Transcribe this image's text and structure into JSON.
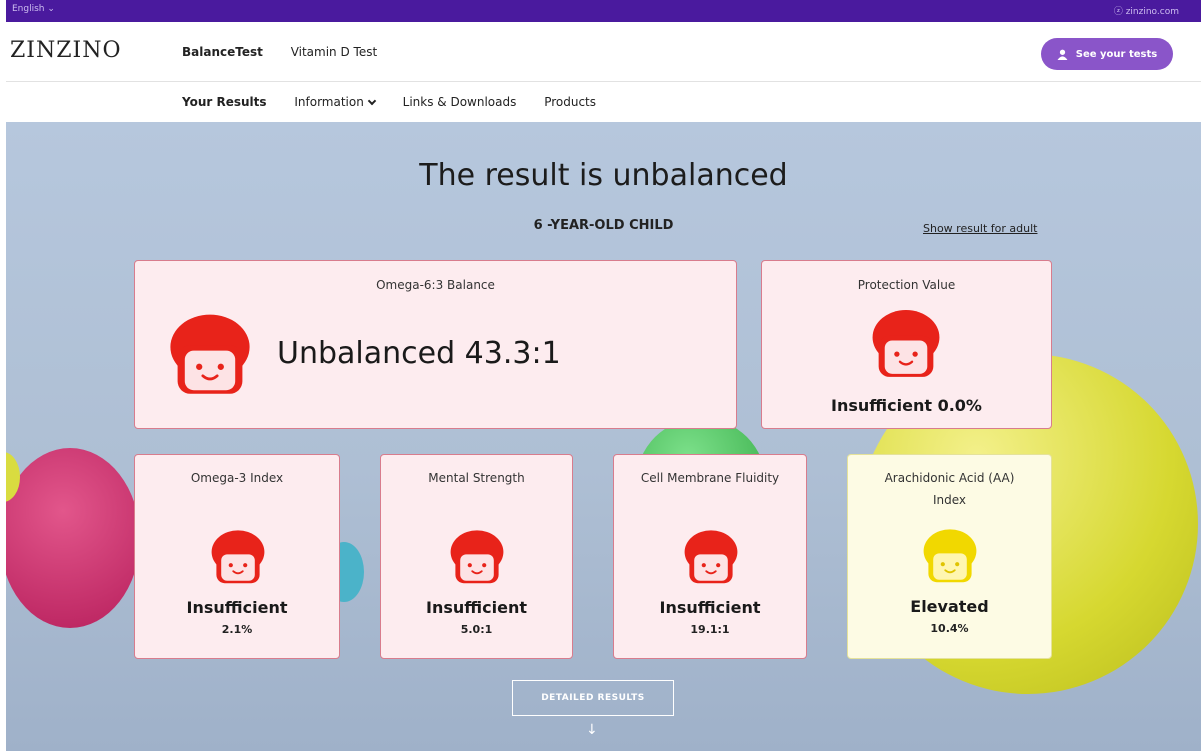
{
  "topbar": {
    "language": "English ⌄",
    "site": "ⓩ zinzino.com"
  },
  "header": {
    "logo": "ZINZINO",
    "nav": [
      "BalanceTest",
      "Vitamin D Test"
    ],
    "cta_label": "See your tests",
    "cta_icon": "user-icon"
  },
  "subnav": {
    "items": [
      "Your Results",
      "Information",
      "Links & Downloads",
      "Products"
    ]
  },
  "hero": {
    "title": "The result is unbalanced",
    "subtitle": "6 -YEAR-OLD CHILD",
    "adult_link": "Show result for adult"
  },
  "cards": {
    "omega_balance": {
      "label": "Omega-6:3 Balance",
      "status": "Unbalanced 43.3:1",
      "color": "#e8231a"
    },
    "protection": {
      "label": "Protection Value",
      "status": "Insufficient 0.0%",
      "color": "#e8231a"
    },
    "omega3": {
      "label": "Omega-3 Index",
      "status": "Insufficient",
      "value": "2.1%",
      "color": "#e8231a"
    },
    "mental": {
      "label": "Mental Strength",
      "status": "Insufficient",
      "value": "5.0:1",
      "color": "#e8231a"
    },
    "membrane": {
      "label": "Cell Membrane Fluidity",
      "status": "Insufficient",
      "value": "19.1:1",
      "color": "#e8231a"
    },
    "aa": {
      "label_line1": "Arachidonic Acid (AA)",
      "label_line2": "Index",
      "status": "Elevated",
      "value": "10.4%",
      "color": "#f1d800"
    }
  },
  "detail_button": "DETAILED RESULTS",
  "colors": {
    "brand": "#4a1a9e",
    "cta": "#8a55c9",
    "insufficient": "#e8231a",
    "elevated": "#f1d800"
  }
}
